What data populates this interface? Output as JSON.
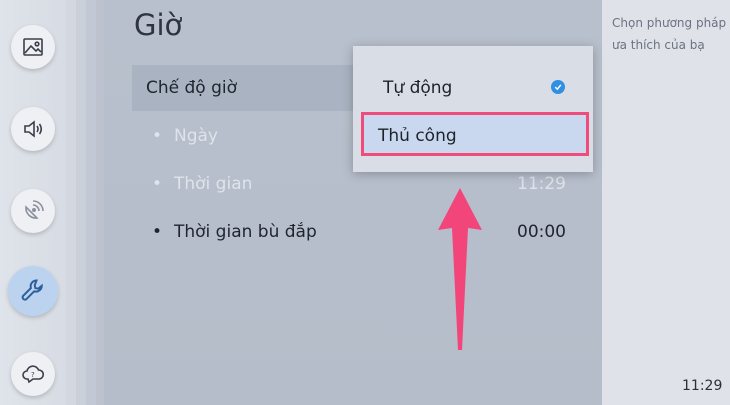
{
  "sidebar": {
    "icons": [
      {
        "name": "picture-icon"
      },
      {
        "name": "sound-icon"
      },
      {
        "name": "broadcast-icon"
      },
      {
        "name": "wrench-icon"
      },
      {
        "name": "support-icon"
      }
    ]
  },
  "page": {
    "title": "Giờ"
  },
  "menu": {
    "rows": [
      {
        "label": "Chế độ giờ",
        "value": ""
      },
      {
        "label": "Ngày",
        "value": ""
      },
      {
        "label": "Thời gian",
        "value": "11:29"
      },
      {
        "label": "Thời gian bù đắp",
        "value": "00:00"
      }
    ],
    "bullet": "•"
  },
  "dropdown": {
    "options": [
      {
        "label": "Tự động",
        "selected": true
      },
      {
        "label": "Thủ công",
        "selected": false
      }
    ]
  },
  "info": {
    "text": "Chọn phương pháp gian ưa thích của bạ"
  },
  "clock": "11:29",
  "colors": {
    "highlight_border": "#f04b7a",
    "check": "#2f8fe3",
    "arrow": "#f2467a"
  }
}
